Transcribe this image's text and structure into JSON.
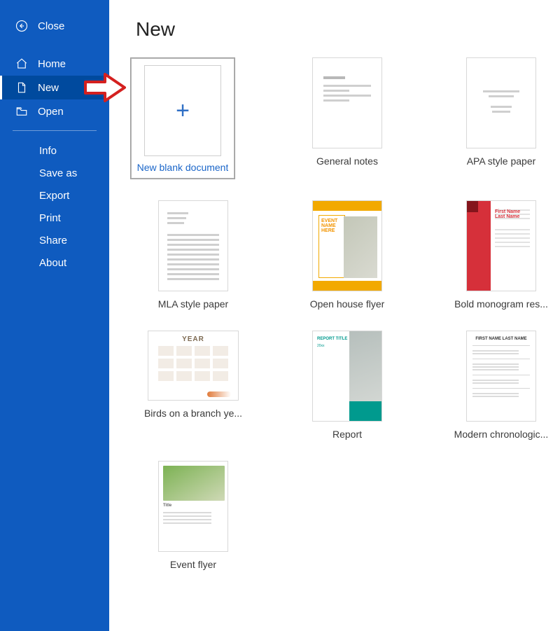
{
  "sidebar": {
    "close": "Close",
    "primary": [
      {
        "id": "home",
        "label": "Home",
        "icon": "home-icon",
        "selected": false
      },
      {
        "id": "new",
        "label": "New",
        "icon": "document-icon",
        "selected": true
      },
      {
        "id": "open",
        "label": "Open",
        "icon": "folder-open-icon",
        "selected": false
      }
    ],
    "secondary": [
      {
        "id": "info",
        "label": "Info"
      },
      {
        "id": "saveas",
        "label": "Save as"
      },
      {
        "id": "export",
        "label": "Export"
      },
      {
        "id": "print",
        "label": "Print"
      },
      {
        "id": "share",
        "label": "Share"
      },
      {
        "id": "about",
        "label": "About"
      }
    ]
  },
  "main": {
    "title": "New",
    "templates": [
      {
        "id": "blank",
        "label": "New blank document",
        "shape": "blank",
        "selected": true
      },
      {
        "id": "notes",
        "label": "General notes",
        "shape": "tall"
      },
      {
        "id": "apa",
        "label": "APA style paper",
        "shape": "tall"
      },
      {
        "id": "mla",
        "label": "MLA style paper",
        "shape": "tall"
      },
      {
        "id": "ohflyer",
        "label": "Open house flyer",
        "shape": "tall"
      },
      {
        "id": "boldres",
        "label": "Bold monogram res...",
        "shape": "tall"
      },
      {
        "id": "birds",
        "label": "Birds on a branch ye...",
        "shape": "wide"
      },
      {
        "id": "report",
        "label": "Report",
        "shape": "tall"
      },
      {
        "id": "chrono",
        "label": "Modern chronologic...",
        "shape": "tall"
      },
      {
        "id": "evflyer",
        "label": "Event flyer",
        "shape": "tall"
      }
    ]
  },
  "thumb_text": {
    "ohflyer_event": "EVENT NAME HERE",
    "birds_year": "YEAR",
    "report_title": "REPORT TITLE",
    "report_sub": "20xx",
    "chrono_name": "FIRST NAME LAST NAME",
    "boldres_name": "First Name Last Name",
    "evflyer_title": "Title"
  }
}
